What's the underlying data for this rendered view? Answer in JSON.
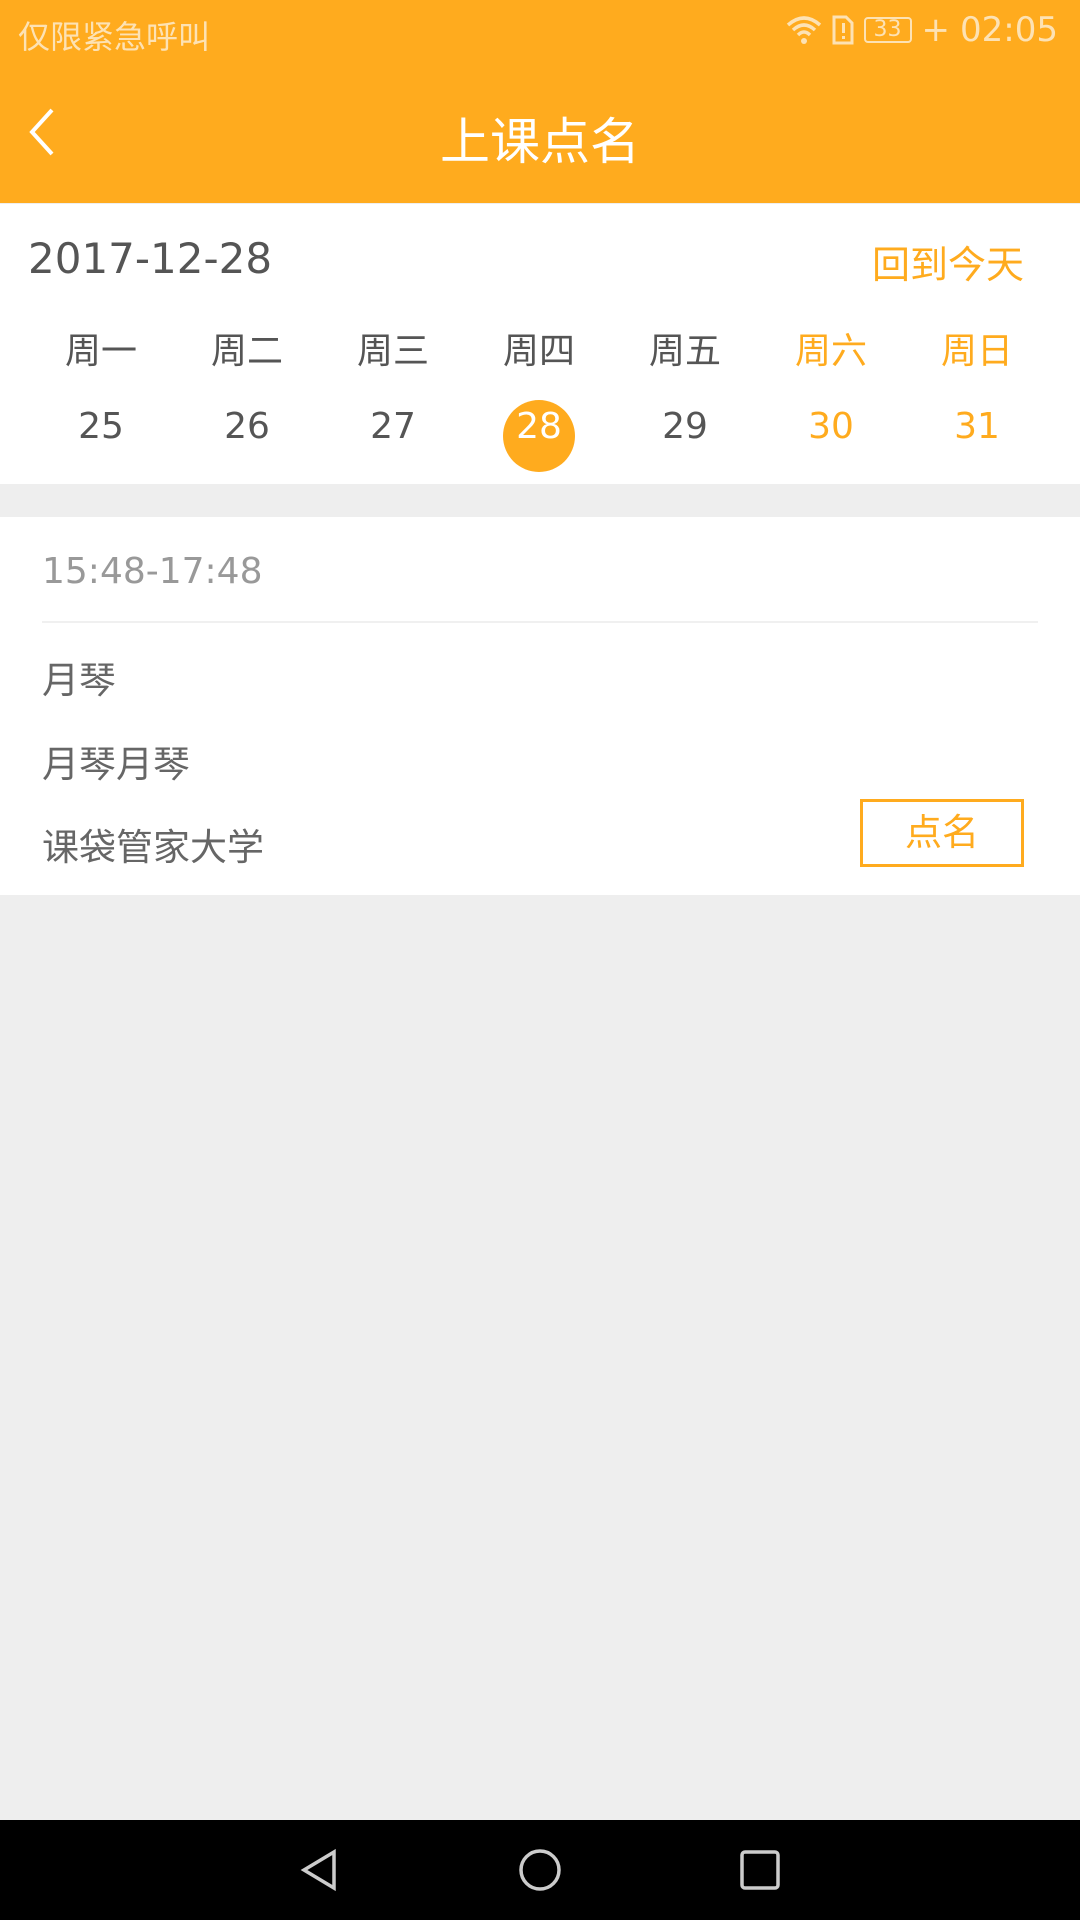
{
  "status_bar": {
    "carrier": "仅限紧急呼叫",
    "battery": "33",
    "time": "02:05",
    "icons": [
      "wifi-icon",
      "sim-alert-icon",
      "battery-icon",
      "charging-icon"
    ]
  },
  "header": {
    "title": "上课点名",
    "back_icon": "chevron-left-icon"
  },
  "calendar": {
    "selected_date": "2017-12-28",
    "today_label": "回到今天",
    "weekdays": [
      "周一",
      "周二",
      "周三",
      "周四",
      "周五",
      "周六",
      "周日"
    ],
    "days": [
      "25",
      "26",
      "27",
      "28",
      "29",
      "30",
      "31"
    ],
    "selected_index": 3
  },
  "lesson": {
    "time": "15:48-17:48",
    "course": "月琴",
    "class_name": "月琴月琴",
    "school": "课袋管家大学",
    "action_label": "点名"
  },
  "colors": {
    "accent": "#ffab1e"
  },
  "nav_bar": {
    "icons": [
      "back-triangle-icon",
      "home-circle-icon",
      "recents-square-icon"
    ]
  }
}
